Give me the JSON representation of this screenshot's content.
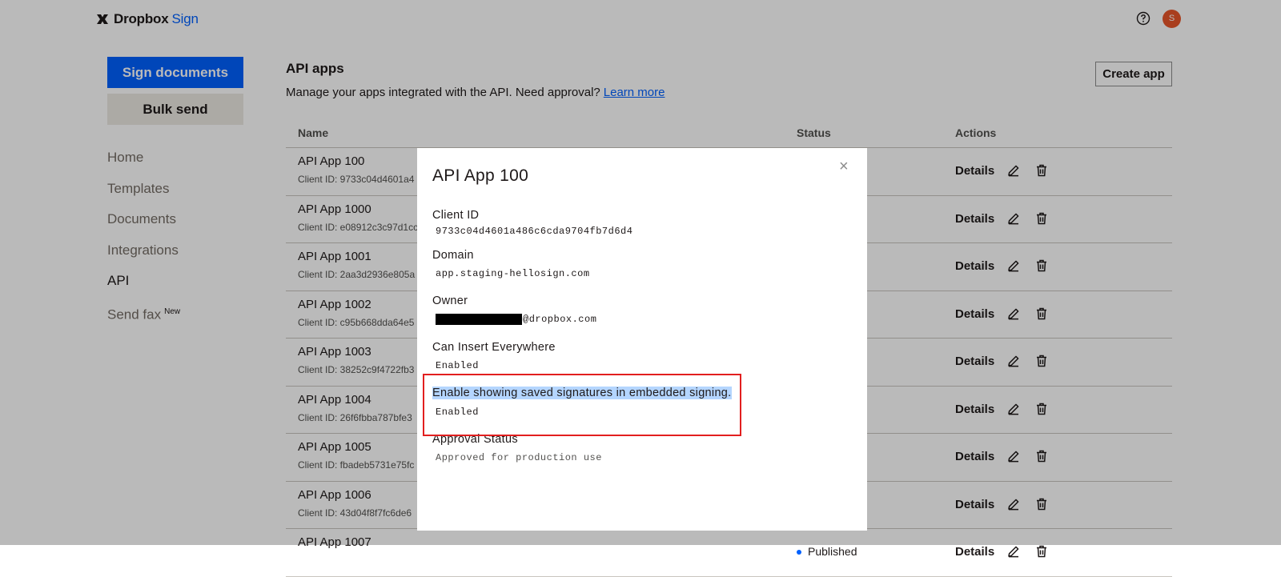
{
  "header": {
    "brand": "Dropbox",
    "brand_product": "Sign",
    "avatar_initial": "S"
  },
  "sidebar": {
    "primary_button": "Sign documents",
    "secondary_button": "Bulk send",
    "items": [
      {
        "label": "Home"
      },
      {
        "label": "Templates"
      },
      {
        "label": "Documents"
      },
      {
        "label": "Integrations"
      },
      {
        "label": "API"
      },
      {
        "label": "Send fax",
        "badge": "New"
      }
    ]
  },
  "main": {
    "title": "API apps",
    "subtitle": "Manage your apps integrated with the API. Need approval?",
    "learn_more": "Learn more",
    "create_button": "Create app",
    "columns": {
      "name": "Name",
      "status": "Status",
      "actions": "Actions"
    },
    "rows": [
      {
        "name": "API App 100",
        "client": "Client ID: 9733c04d4601a4",
        "status": "",
        "details": "Details"
      },
      {
        "name": "API App 1000",
        "client": "Client ID: e08912c3c97d1cc",
        "status": "",
        "details": "Details"
      },
      {
        "name": "API App 1001",
        "client": "Client ID: 2aa3d2936e805a",
        "status": "",
        "details": "Details"
      },
      {
        "name": "API App 1002",
        "client": "Client ID: c95b668dda64e5",
        "status": "",
        "details": "Details"
      },
      {
        "name": "API App 1003",
        "client": "Client ID: 38252c9f4722fb3",
        "status": "",
        "details": "Details"
      },
      {
        "name": "API App 1004",
        "client": "Client ID: 26f6fbba787bfe3",
        "status": "",
        "details": "Details"
      },
      {
        "name": "API App 1005",
        "client": "Client ID: fbadeb5731e75fc",
        "status": "",
        "details": "Details"
      },
      {
        "name": "API App 1006",
        "client": "Client ID: 43d04f8f7fc6de6",
        "status": "",
        "details": "Details"
      },
      {
        "name": "API App 1007",
        "client": "",
        "status": "Published",
        "details": "Details"
      }
    ]
  },
  "modal": {
    "title": "API App 100",
    "close": "×",
    "fields": {
      "client_id_label": "Client ID",
      "client_id_value": "9733c04d4601a486c6cda9704fb7d6d4",
      "domain_label": "Domain",
      "domain_value": "app.staging-hellosign.com",
      "owner_label": "Owner",
      "owner_value": "@dropbox.com",
      "insert_label": "Can Insert Everywhere",
      "insert_value": "Enabled",
      "saved_sig_label": "Enable showing saved signatures in embedded signing.",
      "saved_sig_value": "Enabled",
      "approval_label": "Approval Status",
      "approval_value": "Approved for production use"
    }
  },
  "colors": {
    "brand_blue": "#0061fe",
    "avatar": "#e8562a",
    "highlight_box": "#e21f1f",
    "text_selection": "#b4d5fe"
  }
}
